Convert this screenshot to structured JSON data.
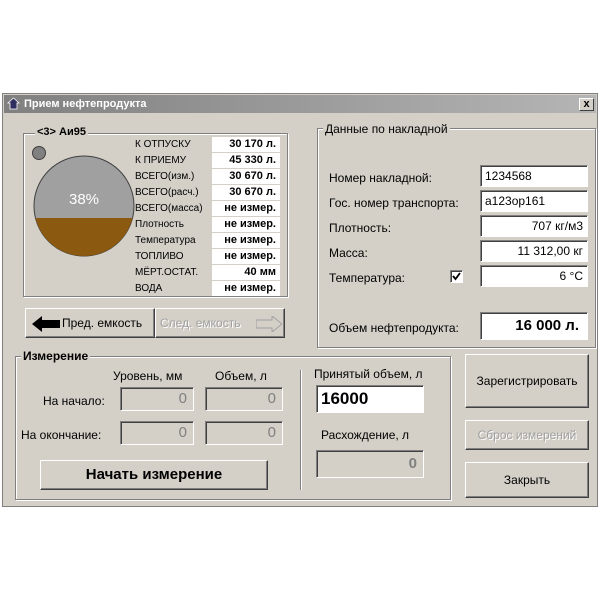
{
  "window": {
    "title": "Прием нефтепродукта",
    "close_label": "x"
  },
  "tank": {
    "name": "<3> Аи95",
    "fill_percent_label": "38%",
    "fill_fraction": 0.38,
    "stats": [
      {
        "label": "К ОТПУСКУ",
        "value": "30 170 л."
      },
      {
        "label": "К ПРИЕМУ",
        "value": "45 330 л."
      },
      {
        "label": "ВСЕГО(изм.)",
        "value": "30 670 л."
      },
      {
        "label": "ВСЕГО(расч.)",
        "value": "30 670 л."
      },
      {
        "label": "ВСЕГО(масса)",
        "value": "не измер."
      },
      {
        "label": "Плотность",
        "value": "не измер."
      },
      {
        "label": "Температура",
        "value": "не измер."
      },
      {
        "label": "ТОПЛИВО",
        "value": "не измер."
      },
      {
        "label": "МЁРТ.ОСТАТ.",
        "value": "40 мм"
      },
      {
        "label": "ВОДА",
        "value": "не измер."
      }
    ],
    "prev_button": "Пред. емкость",
    "next_button": "След. емкость"
  },
  "invoice": {
    "legend": "Данные по накладной",
    "number_label": "Номер накладной:",
    "number_value": "1234568",
    "vehicle_label": "Гос. номер транспорта:",
    "vehicle_value": "а123ор161",
    "density_label": "Плотность:",
    "density_value": "707 кг/м3",
    "mass_label": "Масса:",
    "mass_value": "11 312,00 кг",
    "temp_label": "Температура:",
    "temp_checked": true,
    "temp_value": "6 °C",
    "volume_label": "Объем нефтепродукта:",
    "volume_value": "16 000 л."
  },
  "measurement": {
    "legend": "Измерение",
    "level_header": "Уровень, мм",
    "volume_header": "Объем, л",
    "start_label": "На начало:",
    "end_label": "На окончание:",
    "start_level": "0",
    "start_volume": "0",
    "end_level": "0",
    "end_volume": "0",
    "accepted_label": "Принятый объем, л",
    "accepted_value": "16000",
    "diff_label": "Расхождение, л",
    "diff_value": "0",
    "start_button": "Начать измерение"
  },
  "actions": {
    "register": "Зарегистрировать",
    "reset": "Сброс измерений",
    "close": "Закрыть"
  },
  "colors": {
    "fuel": "#8b5a10",
    "empty": "#a0a0a0",
    "indicator": "#808080"
  }
}
